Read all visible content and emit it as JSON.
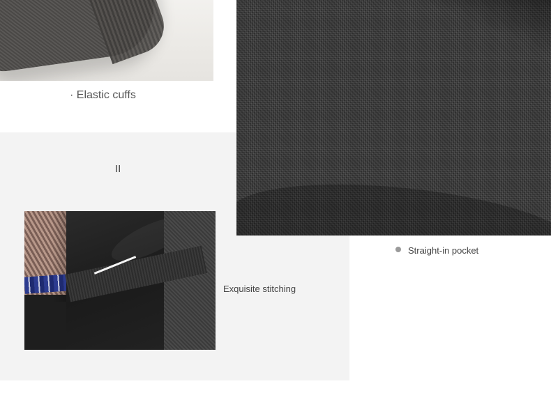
{
  "captions": {
    "elastic_cuffs": "· Elastic cuffs",
    "section_marker": "II",
    "straight_in_pocket": "Straight-in pocket",
    "exquisite_stitching": "Exquisite stitching"
  },
  "colors": {
    "background": "#ffffff",
    "panel": "#f3f3f3",
    "text": "#555555",
    "bullet": "#9a9a9a"
  }
}
